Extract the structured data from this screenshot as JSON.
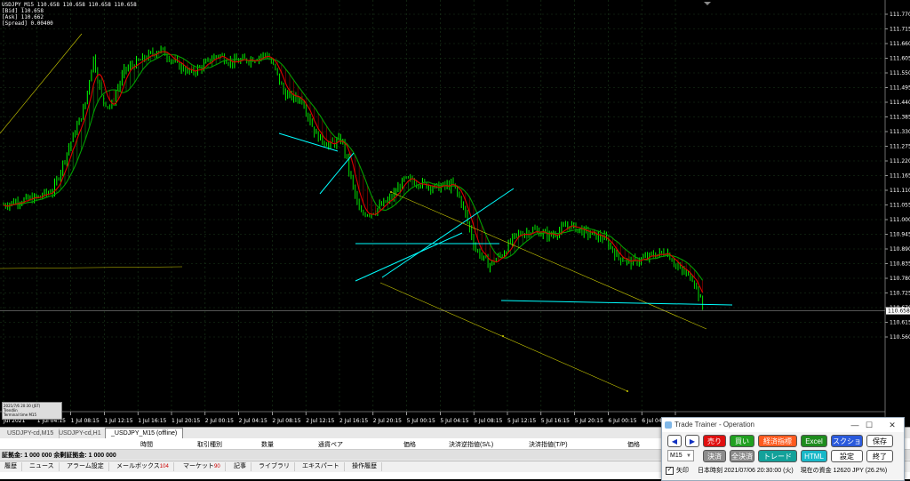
{
  "chart": {
    "info_lines": [
      "USDJPY_M15  110.658 110.658 110.658 110.658",
      "[Bid]  110.658",
      "[Ask]  110.662",
      "[Spread]  0.00400"
    ],
    "current_price": "110.658",
    "price_ticks": [
      "111.770",
      "111.715",
      "111.660",
      "111.605",
      "111.550",
      "111.495",
      "111.440",
      "111.385",
      "111.330",
      "111.275",
      "111.220",
      "111.165",
      "111.110",
      "111.055",
      "111.000",
      "110.945",
      "110.890",
      "110.835",
      "110.780",
      "110.725",
      "110.670",
      "110.615",
      "110.560"
    ],
    "time_ticks": [
      "Jul 2021",
      "1 Jul 04:15",
      "1 Jul 08:15",
      "1 Jul 12:15",
      "1 Jul 16:15",
      "1 Jul 20:15",
      "2 Jul 00:15",
      "2 Jul 04:15",
      "2 Jul 08:15",
      "2 Jul 12:15",
      "2 Jul 16:15",
      "2 Jul 20:15",
      "5 Jul 00:15",
      "5 Jul 04:15",
      "5 Jul 08:15",
      "5 Jul 12:15",
      "5 Jul 16:15",
      "5 Jul 20:15",
      "6 Jul 00:15",
      "6 Jul 04:15",
      "6 Jul 08:15"
    ],
    "colors": {
      "bull": "#00ff00",
      "bear": "#00dd00",
      "ma_fast": "#e00000",
      "ma_slow": "#00a000",
      "trend": "#00ffff",
      "channel": "#cccc00",
      "grid": "#1c3a1c"
    },
    "mini_panel": [
      "2021/7/6 20:30 (JST)",
      "Trendlin",
      "Terminal time    M15"
    ]
  },
  "chart_tabs": [
    "USDJPY-cd,M15",
    "USDJPY-cd,H1",
    "_USDJPY_M15 (offline)"
  ],
  "terminal": {
    "columns": [
      "時間",
      "取引種別",
      "数量",
      "通貨ペア",
      "価格",
      "決済逆指値(S/L)",
      "決済指値(T/P)",
      "価格"
    ],
    "balance": "証拠金: 1 000 000  余剰証拠金: 1 000 000",
    "tabs": [
      {
        "label": "履歴",
        "count": ""
      },
      {
        "label": "ニュース",
        "count": ""
      },
      {
        "label": "アラーム設定",
        "count": ""
      },
      {
        "label": "メールボックス",
        "count": "104"
      },
      {
        "label": "マーケット",
        "count": "90"
      },
      {
        "label": "記事",
        "count": ""
      },
      {
        "label": "ライブラリ",
        "count": ""
      },
      {
        "label": "エキスパート",
        "count": ""
      },
      {
        "label": "操作履歴",
        "count": ""
      }
    ]
  },
  "trainer": {
    "title": "Trade Trainer - Operation",
    "win_min": "—",
    "win_max": "☐",
    "win_close": "✕",
    "row1": [
      {
        "label": "◀",
        "bg": "#ffffff",
        "fg": "#1030c0"
      },
      {
        "label": "▶",
        "bg": "#ffffff",
        "fg": "#1030c0"
      },
      {
        "label": "売り",
        "bg": "#e01010",
        "fg": "#ffffff"
      },
      {
        "label": "買い",
        "bg": "#20a020",
        "fg": "#ffffff"
      },
      {
        "label": "経済指標",
        "bg": "#ff5a1e",
        "fg": "#ffffff"
      },
      {
        "label": "Excel",
        "bg": "#1e8c1e",
        "fg": "#ffffff"
      },
      {
        "label": "スクショ",
        "bg": "#2a5adc",
        "fg": "#ffffff"
      },
      {
        "label": "保存",
        "bg": "#ffffff",
        "fg": "#000000"
      }
    ],
    "timeframe": "M15",
    "row2": [
      {
        "label": "決済",
        "bg": "#8c8c8c",
        "fg": "#ffffff"
      },
      {
        "label": "全決済",
        "bg": "#8c8c8c",
        "fg": "#ffffff"
      },
      {
        "label": "トレード",
        "bg": "#13a19a",
        "fg": "#ffffff"
      },
      {
        "label": "HTML",
        "bg": "#18b8c8",
        "fg": "#ffffff"
      },
      {
        "label": "設定",
        "bg": "#ffffff",
        "fg": "#000000"
      },
      {
        "label": "終了",
        "bg": "#ffffff",
        "fg": "#000000"
      }
    ],
    "status": {
      "check_label": "矢印",
      "time_label": "日本時刻 2021/07/06 20:30:00 (火)",
      "fund_label": "現在の資金 12620 JPY (26.2%)"
    }
  }
}
